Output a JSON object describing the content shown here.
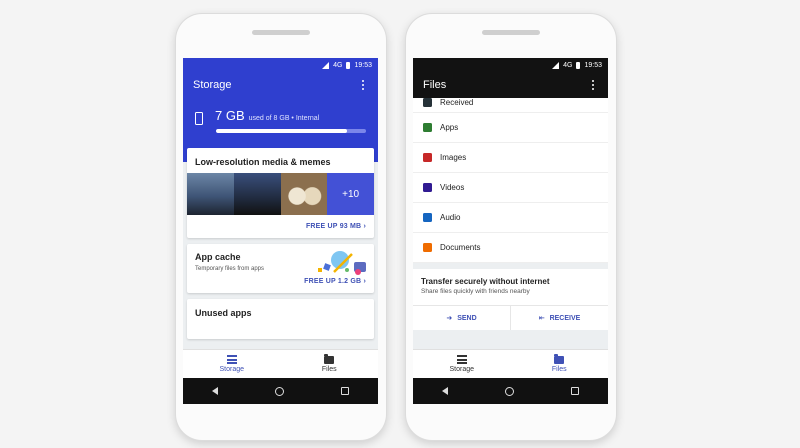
{
  "status": {
    "network": "4G",
    "time": "19:53"
  },
  "storage_screen": {
    "title": "Storage",
    "used": "7 GB",
    "detail": "used of 8 GB • Internal",
    "used_fraction": 0.87,
    "header_color": "#2f3fcf",
    "cards": {
      "media": {
        "title": "Low-resolution media & memes",
        "more_count": "+10",
        "action": "FREE UP 93 MB"
      },
      "cache": {
        "title": "App cache",
        "subtitle": "Temporary files from apps",
        "action": "FREE UP 1.2 GB"
      },
      "unused": {
        "title": "Unused apps"
      }
    }
  },
  "files_screen": {
    "title": "Files",
    "categories": [
      {
        "label": "Received",
        "icon": "download-icon",
        "color": "#263238"
      },
      {
        "label": "Apps",
        "icon": "android-icon",
        "color": "#2e7d32"
      },
      {
        "label": "Images",
        "icon": "image-icon",
        "color": "#c62828"
      },
      {
        "label": "Videos",
        "icon": "video-icon",
        "color": "#311b92"
      },
      {
        "label": "Audio",
        "icon": "headphones-icon",
        "color": "#1565c0"
      },
      {
        "label": "Documents",
        "icon": "document-icon",
        "color": "#ef6c00"
      }
    ],
    "transfer": {
      "title": "Transfer securely without internet",
      "subtitle": "Share files quickly with friends nearby",
      "send": "SEND",
      "receive": "RECEIVE"
    }
  },
  "bottom_nav": {
    "storage": "Storage",
    "files": "Files"
  },
  "accent": "#3f51b5"
}
